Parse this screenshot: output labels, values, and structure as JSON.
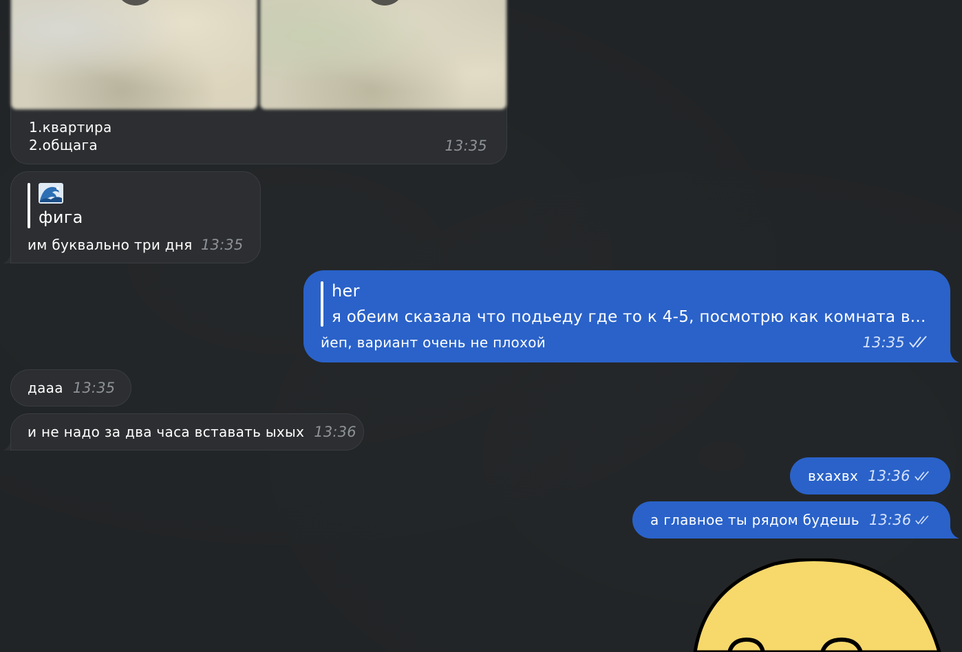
{
  "chat": {
    "messages": [
      {
        "id": "album",
        "direction": "incoming",
        "media": [
          "video-thumbnail",
          "video-thumbnail"
        ],
        "caption_lines": [
          "1.квартира",
          "2.общага"
        ],
        "time": "13:35"
      },
      {
        "id": "figa",
        "direction": "incoming",
        "reply": {
          "emoji": "🌊",
          "text": "фига"
        },
        "text": "им буквально три дня",
        "time": "13:35"
      },
      {
        "id": "yep",
        "direction": "outgoing",
        "reply": {
          "author": "her",
          "text": "я обеим сказала что подьеду где то к 4-5, посмотрю как комната в..."
        },
        "text": "йеп, вариант очень не плохой",
        "time": "13:35",
        "status": "read"
      },
      {
        "id": "daaa",
        "direction": "incoming",
        "text": "дааа",
        "time": "13:35"
      },
      {
        "id": "ne-nado",
        "direction": "incoming",
        "text": "и не надо за два часа вставать ыхых",
        "time": "13:36"
      },
      {
        "id": "vhah",
        "direction": "outgoing",
        "text": "вхахвх",
        "time": "13:36",
        "status": "read"
      },
      {
        "id": "glavnoe",
        "direction": "outgoing",
        "text": "а главное ты рядом будешь",
        "time": "13:36",
        "status": "read"
      },
      {
        "id": "sticker",
        "direction": "outgoing",
        "media": "sticker-yellow-face"
      }
    ]
  },
  "colors": {
    "background": "#212426",
    "incoming_bubble": "#2c2e31",
    "outgoing_bubble": "#2a62c9",
    "sticker_yellow": "#f7d86a"
  },
  "icons": {
    "read_status": "double-check-icon",
    "play": "play-icon"
  }
}
